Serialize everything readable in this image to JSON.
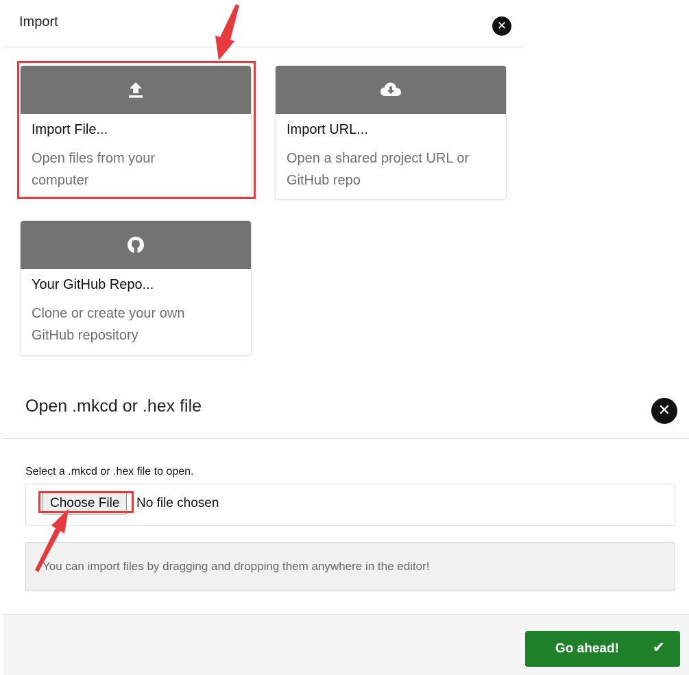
{
  "import_panel": {
    "title": "Import",
    "close_icon": "close-circle-icon",
    "cards": [
      {
        "icon": "upload-icon",
        "title": "Import File...",
        "description": "Open files from your computer"
      },
      {
        "icon": "cloud-download-icon",
        "title": "Import URL...",
        "description": "Open a shared project URL or GitHub repo"
      },
      {
        "icon": "github-icon",
        "title": "Your GitHub Repo...",
        "description": "Clone or create your own GitHub repository"
      }
    ]
  },
  "file_dialog": {
    "title": "Open .mkcd or .hex file",
    "close_icon": "close-circle-icon",
    "field_label": "Select a .mkcd or .hex file to open.",
    "choose_file_label": "Choose File",
    "no_file_text": "No file chosen",
    "info_text": "You can import files by dragging and dropping them anywhere in the editor!",
    "confirm_label": "Go ahead!",
    "confirm_icon": "check-icon"
  },
  "annotations": {
    "highlight_color": "#e8393c",
    "header_gray": "#737373",
    "confirm_green": "#1e8028"
  }
}
